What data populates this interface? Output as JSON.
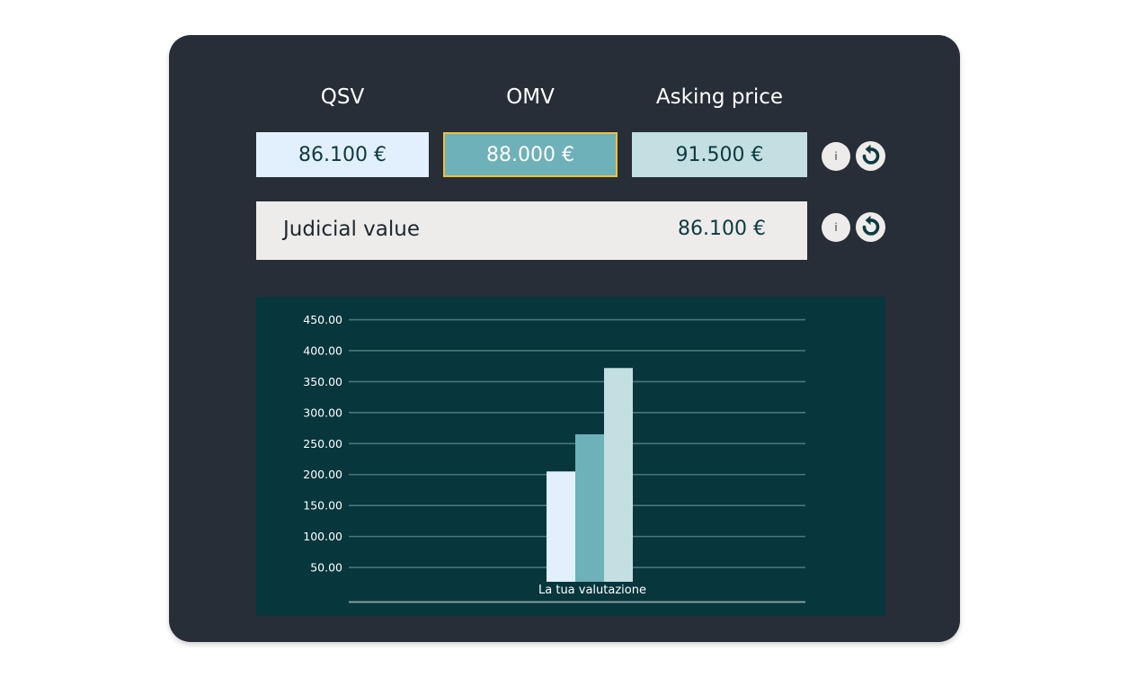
{
  "columns": [
    {
      "label": "QSV",
      "value": "86.100 €",
      "color": "#e2effc"
    },
    {
      "label": "OMV",
      "value": "88.000 €",
      "color": "#6eb1b8",
      "selected": true,
      "border_color": "#e9c043"
    },
    {
      "label": "Asking price",
      "value": "91.500 €",
      "color": "#c4dfe1"
    }
  ],
  "judicial": {
    "label": "Judicial value",
    "value": "86.100 €"
  },
  "buttons": {
    "info_glyph": "i"
  },
  "icons": {
    "info": "info-icon",
    "reset": "reset-icon"
  },
  "colors": {
    "card_bg": "#272e37",
    "chart_bg": "#07363d",
    "row_bg": "#edecea",
    "gridline": "#4c7679"
  },
  "chart_data": {
    "type": "bar",
    "categories": [
      "La tua valutazione"
    ],
    "series": [
      {
        "values": [
          205
        ],
        "color": "#e2effc"
      },
      {
        "values": [
          265
        ],
        "color": "#6eb1b8"
      },
      {
        "values": [
          372
        ],
        "color": "#c4dfe1"
      }
    ],
    "yticks": [
      "50.00",
      "100.00",
      "150.00",
      "200.00",
      "250.00",
      "300.00",
      "350.00",
      "400.00",
      "450.00"
    ],
    "grid": true,
    "legend": "none"
  }
}
